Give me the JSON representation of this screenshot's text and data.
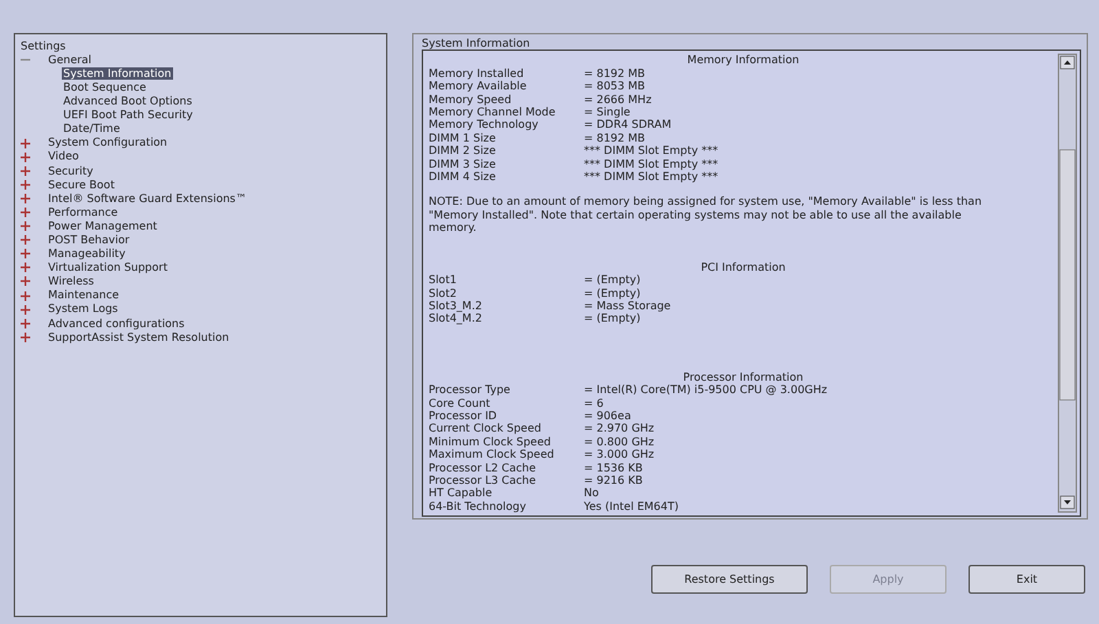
{
  "tree": {
    "title": "Settings",
    "items": [
      {
        "label": "General",
        "expanded": true,
        "selected": false,
        "children": [
          {
            "label": "System Information",
            "selected": true
          },
          {
            "label": "Boot Sequence",
            "selected": false
          },
          {
            "label": "Advanced Boot Options",
            "selected": false
          },
          {
            "label": "UEFI Boot Path Security",
            "selected": false
          },
          {
            "label": "Date/Time",
            "selected": false
          }
        ]
      },
      {
        "label": "System Configuration",
        "expanded": false,
        "selected": false
      },
      {
        "label": "Video",
        "expanded": false,
        "selected": false
      },
      {
        "label": "Security",
        "expanded": false,
        "selected": false
      },
      {
        "label": "Secure Boot",
        "expanded": false,
        "selected": false
      },
      {
        "label": "Intel® Software Guard Extensions™",
        "expanded": false,
        "selected": false
      },
      {
        "label": "Performance",
        "expanded": false,
        "selected": false
      },
      {
        "label": "Power Management",
        "expanded": false,
        "selected": false
      },
      {
        "label": "POST Behavior",
        "expanded": false,
        "selected": false
      },
      {
        "label": "Manageability",
        "expanded": false,
        "selected": false
      },
      {
        "label": "Virtualization Support",
        "expanded": false,
        "selected": false
      },
      {
        "label": "Wireless",
        "expanded": false,
        "selected": false
      },
      {
        "label": "Maintenance",
        "expanded": false,
        "selected": false
      },
      {
        "label": "System Logs",
        "expanded": false,
        "selected": false
      },
      {
        "label": "Advanced configurations",
        "expanded": false,
        "selected": false
      },
      {
        "label": "SupportAssist System Resolution",
        "expanded": false,
        "selected": false
      }
    ]
  },
  "panel": {
    "title": "System Information",
    "sections": [
      {
        "kind": "table",
        "heading": "Memory Information",
        "rows": [
          {
            "label": "Memory Installed",
            "value": "= 8192 MB"
          },
          {
            "label": "Memory Available",
            "value": "= 8053 MB"
          },
          {
            "label": "Memory Speed",
            "value": "= 2666 MHz"
          },
          {
            "label": "Memory Channel Mode",
            "value": "= Single"
          },
          {
            "label": "Memory Technology",
            "value": "= DDR4 SDRAM"
          },
          {
            "label": "DIMM 1 Size",
            "value": "= 8192 MB"
          },
          {
            "label": "DIMM 2 Size",
            "value": "*** DIMM Slot Empty ***"
          },
          {
            "label": "DIMM 3 Size",
            "value": "*** DIMM Slot Empty ***"
          },
          {
            "label": "DIMM 4 Size",
            "value": "*** DIMM Slot Empty ***"
          }
        ]
      },
      {
        "kind": "note",
        "text": "NOTE: Due to an amount of memory being assigned for system use, \"Memory Available\" is less than \"Memory Installed\". Note that certain operating systems may not be able to use all the available memory."
      },
      {
        "kind": "table",
        "heading": "PCI Information",
        "rows": [
          {
            "label": "Slot1",
            "value": "= (Empty)"
          },
          {
            "label": "Slot2",
            "value": "= (Empty)"
          },
          {
            "label": "Slot3_M.2",
            "value": "= Mass Storage"
          },
          {
            "label": "Slot4_M.2",
            "value": "= (Empty)"
          }
        ]
      },
      {
        "kind": "table",
        "heading": "Processor Information",
        "rows": [
          {
            "label": "Processor Type",
            "value": "= Intel(R) Core(TM) i5-9500 CPU @ 3.00GHz"
          },
          {
            "label": "Core Count",
            "value": "= 6"
          },
          {
            "label": "Processor ID",
            "value": "= 906ea"
          },
          {
            "label": "Current Clock Speed",
            "value": "= 2.970 GHz"
          },
          {
            "label": "Minimum Clock Speed",
            "value": "= 0.800 GHz"
          },
          {
            "label": "Maximum Clock Speed",
            "value": "= 3.000 GHz"
          },
          {
            "label": "Processor L2 Cache",
            "value": "= 1536 KB"
          },
          {
            "label": "Processor L3 Cache",
            "value": "= 9216 KB"
          },
          {
            "label": "HT Capable",
            "value": "No"
          },
          {
            "label": "64-Bit Technology",
            "value": "Yes (Intel EM64T)"
          }
        ]
      }
    ]
  },
  "buttons": [
    {
      "label": "Restore Settings",
      "disabled": false
    },
    {
      "label": "Apply",
      "disabled": true
    },
    {
      "label": "Exit",
      "disabled": false
    }
  ]
}
